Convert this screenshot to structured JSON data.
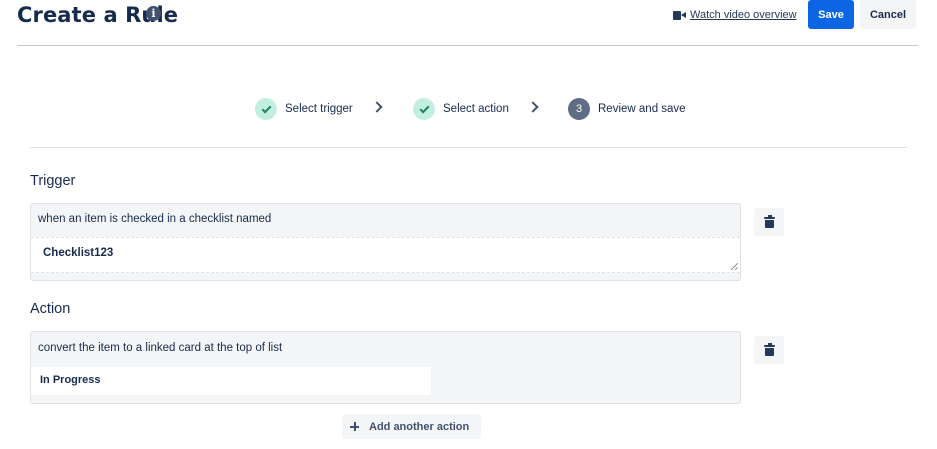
{
  "header": {
    "title": "Create a Rule",
    "info_icon": "info-icon",
    "video_link_label": "Watch video overview",
    "video_icon": "video-camera-icon",
    "save_label": "Save",
    "cancel_label": "Cancel"
  },
  "stepper": {
    "steps": [
      {
        "label": "Select trigger",
        "state": "done"
      },
      {
        "label": "Select action",
        "state": "done"
      },
      {
        "label": "Review and save",
        "state": "current",
        "number": "3"
      }
    ]
  },
  "trigger": {
    "heading": "Trigger",
    "description": "when an item is checked in a checklist named",
    "value": "Checklist123"
  },
  "action": {
    "heading": "Action",
    "description": "convert the item to a linked card at the top of list",
    "value": "In Progress",
    "add_label": "Add another action"
  },
  "colors": {
    "primary": "#0c66e4",
    "done_step": "#c3efe0",
    "current_step": "#5e6c84",
    "card_bg": "#f4f5f7"
  }
}
